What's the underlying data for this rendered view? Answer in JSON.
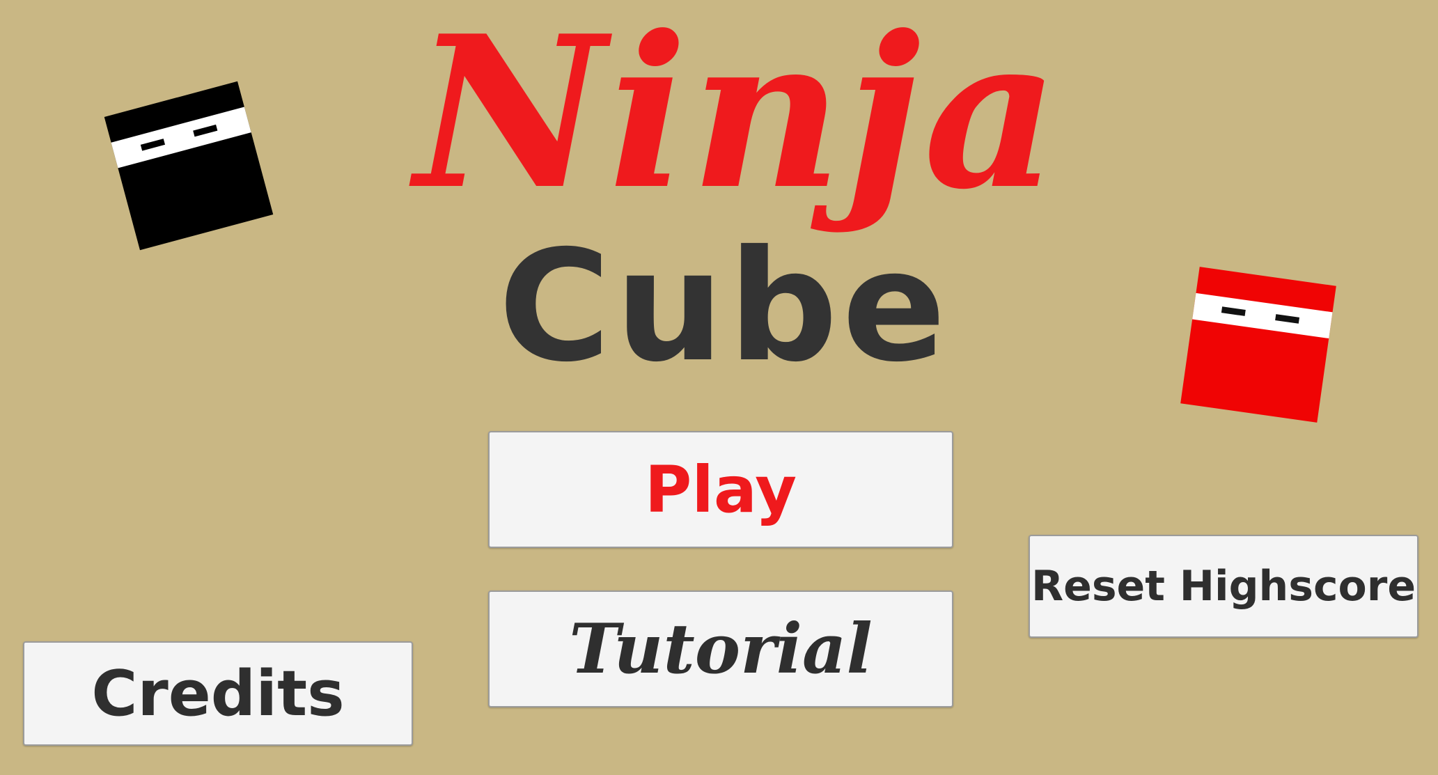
{
  "title": {
    "line1": "Ninja",
    "line2": "Cube"
  },
  "colors": {
    "background": "#c9b784",
    "title_red": "#ef1a1d",
    "title_dark": "#333333",
    "button_bg": "#f4f4f4",
    "cube_black": "#000000",
    "cube_red": "#f00404"
  },
  "decor": {
    "black_cube_icon": "ninja-cube-black",
    "red_cube_icon": "ninja-cube-red"
  },
  "menu": {
    "play_label": "Play",
    "tutorial_label": "Tutorial",
    "credits_label": "Credits",
    "reset_highscore_label": "Reset Highscore"
  }
}
